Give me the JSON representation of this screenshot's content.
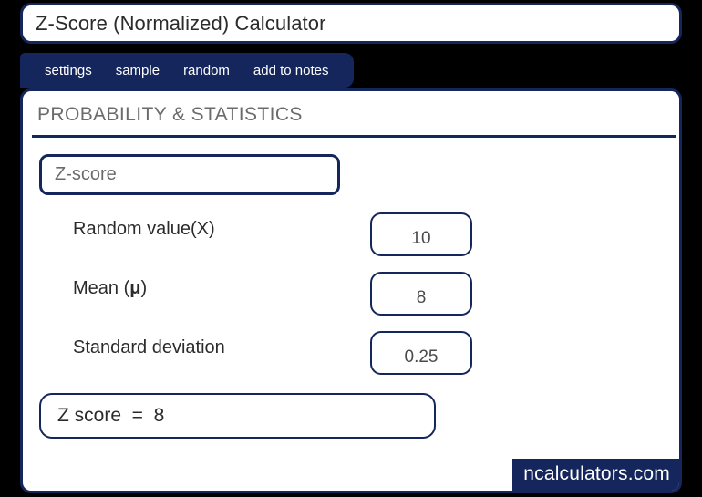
{
  "theme": {
    "navy": "#14265c",
    "page_background": "#000000",
    "panel_background": "#ffffff",
    "label_text": "#2b2b2b",
    "muted_text": "#6b6b6b"
  },
  "titlebar": {
    "title": "Z-Score (Normalized) Calculator"
  },
  "tabs": [
    {
      "label": "settings"
    },
    {
      "label": "sample"
    },
    {
      "label": "random"
    },
    {
      "label": "add to notes"
    }
  ],
  "section": {
    "heading": "PROBABILITY & STATISTICS"
  },
  "selector": {
    "value": "Z-score"
  },
  "fields": [
    {
      "label": "Random value(X)",
      "value": "10"
    },
    {
      "label": "Mean (",
      "label_bold": "μ",
      "label_suffix": ")",
      "value": "8"
    },
    {
      "label": "Standard deviation",
      "value": "0.25"
    }
  ],
  "result": {
    "text": "Z score  =  8"
  },
  "watermark": {
    "text": "ncalculators.com"
  }
}
